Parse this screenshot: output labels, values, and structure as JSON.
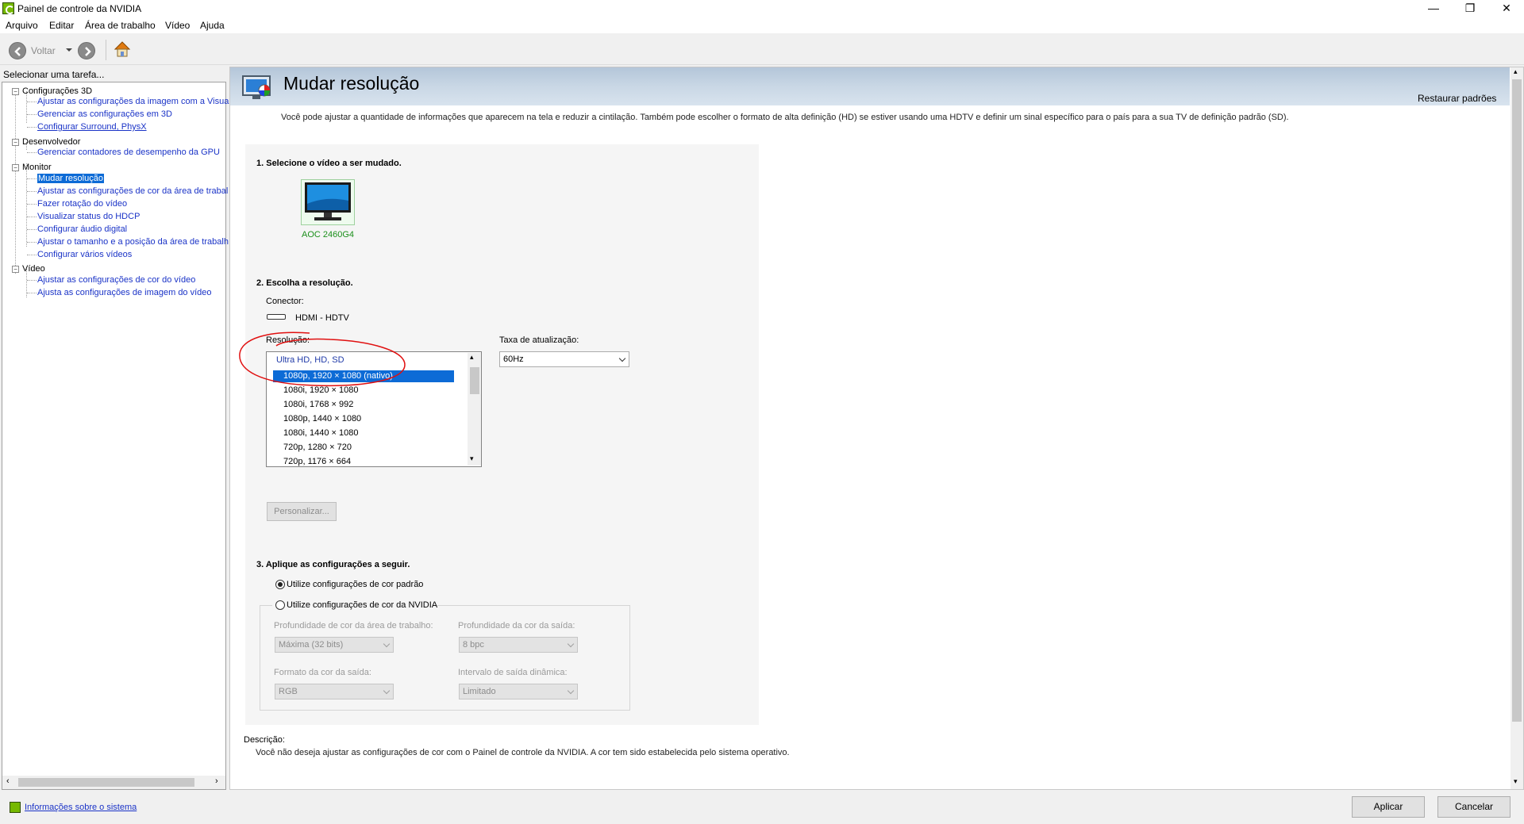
{
  "window": {
    "title": "Painel de controle da NVIDIA",
    "minimize": "—",
    "restore": "❐",
    "close": "✕"
  },
  "menu": [
    {
      "label": "Arquivo"
    },
    {
      "label": "Editar"
    },
    {
      "label": "Área de trabalho"
    },
    {
      "label": "Vídeo"
    },
    {
      "label": "Ajuda"
    }
  ],
  "toolbar": {
    "back_label": "Voltar",
    "back_icon": "back-arrow-icon",
    "forward_icon": "forward-arrow-icon",
    "home_icon": "home-icon"
  },
  "left": {
    "header": "Selecionar uma tarefa...",
    "tree": {
      "cat_3d": "Configurações 3D",
      "item_3d_1": "Ajustar as configurações da imagem com a Visuali",
      "item_3d_2": "Gerenciar as configurações em 3D",
      "item_3d_3": "Configurar Surround, PhysX",
      "cat_dev": "Desenvolvedor",
      "item_dev_1": "Gerenciar contadores de desempenho da GPU",
      "cat_mon": "Monitor",
      "item_mon_1": "Mudar resolução",
      "item_mon_2": "Ajustar as configurações de cor da área de trabal",
      "item_mon_3": "Fazer rotação do vídeo",
      "item_mon_4": "Visualizar status do HDCP",
      "item_mon_5": "Configurar áudio digital",
      "item_mon_6": "Ajustar o tamanho e a posição da área de trabalh",
      "item_mon_7": "Configurar vários vídeos",
      "cat_vid": "Vídeo",
      "item_vid_1": "Ajustar as configurações de cor do vídeo",
      "item_vid_2": "Ajusta as configurações de imagem do vídeo"
    },
    "info_link": "Informações sobre o sistema"
  },
  "main": {
    "title": "Mudar resolução",
    "restore_defaults": "Restaurar padrões",
    "intro": "Você pode ajustar a quantidade de informações que aparecem na tela e reduzir  a cintilação. Também pode escolher o formato de alta definição (HD) se estiver usando uma HDTV e definir um sinal específico para o país para a sua TV de definição padrão (SD).",
    "step1": "1. Selecione o vídeo a ser mudado.",
    "monitor_name": "AOC 2460G4",
    "step2": "2. Escolha a resolução.",
    "connector_label": "Conector:",
    "connector_value": "HDMI - HDTV",
    "resolution_label": "Resolução:",
    "resolution_group": "Ultra HD, HD, SD",
    "resolutions": [
      "1080p, 1920 × 1080 (nativo)",
      "1080i, 1920 × 1080",
      "1080i, 1768 × 992",
      "1080p, 1440 × 1080",
      "1080i, 1440 × 1080",
      "720p, 1280 × 720",
      "720p, 1176 × 664"
    ],
    "refresh_label": "Taxa de atualização:",
    "refresh_value": "60Hz",
    "customize_button": "Personalizar...",
    "step3": "3. Aplique as configurações a seguir.",
    "radio_default": "Utilize configurações de cor padrão",
    "radio_nvidia": "Utilize configurações de cor da NVIDIA",
    "desktop_depth_label": "Profundidade de cor da área de trabalho:",
    "desktop_depth_value": "Máxima (32 bits)",
    "output_depth_label": "Profundidade da cor da saída:",
    "output_depth_value": "8 bpc",
    "output_format_label": "Formato da cor da saída:",
    "output_format_value": "RGB",
    "dynamic_range_label": "Intervalo de saída dinâmica:",
    "dynamic_range_value": "Limitado",
    "description_label": "Descrição:",
    "description_text": "Você não deseja ajustar as configurações de cor com o Painel de controle da NVIDIA. A cor tem sido estabelecida pelo sistema operativo."
  },
  "footer": {
    "apply": "Aplicar",
    "cancel": "Cancelar"
  },
  "colors": {
    "selection": "#0d6bd6",
    "link": "#1a33c7",
    "nvidia_green": "#76b900",
    "annotation_red": "#e01010"
  }
}
